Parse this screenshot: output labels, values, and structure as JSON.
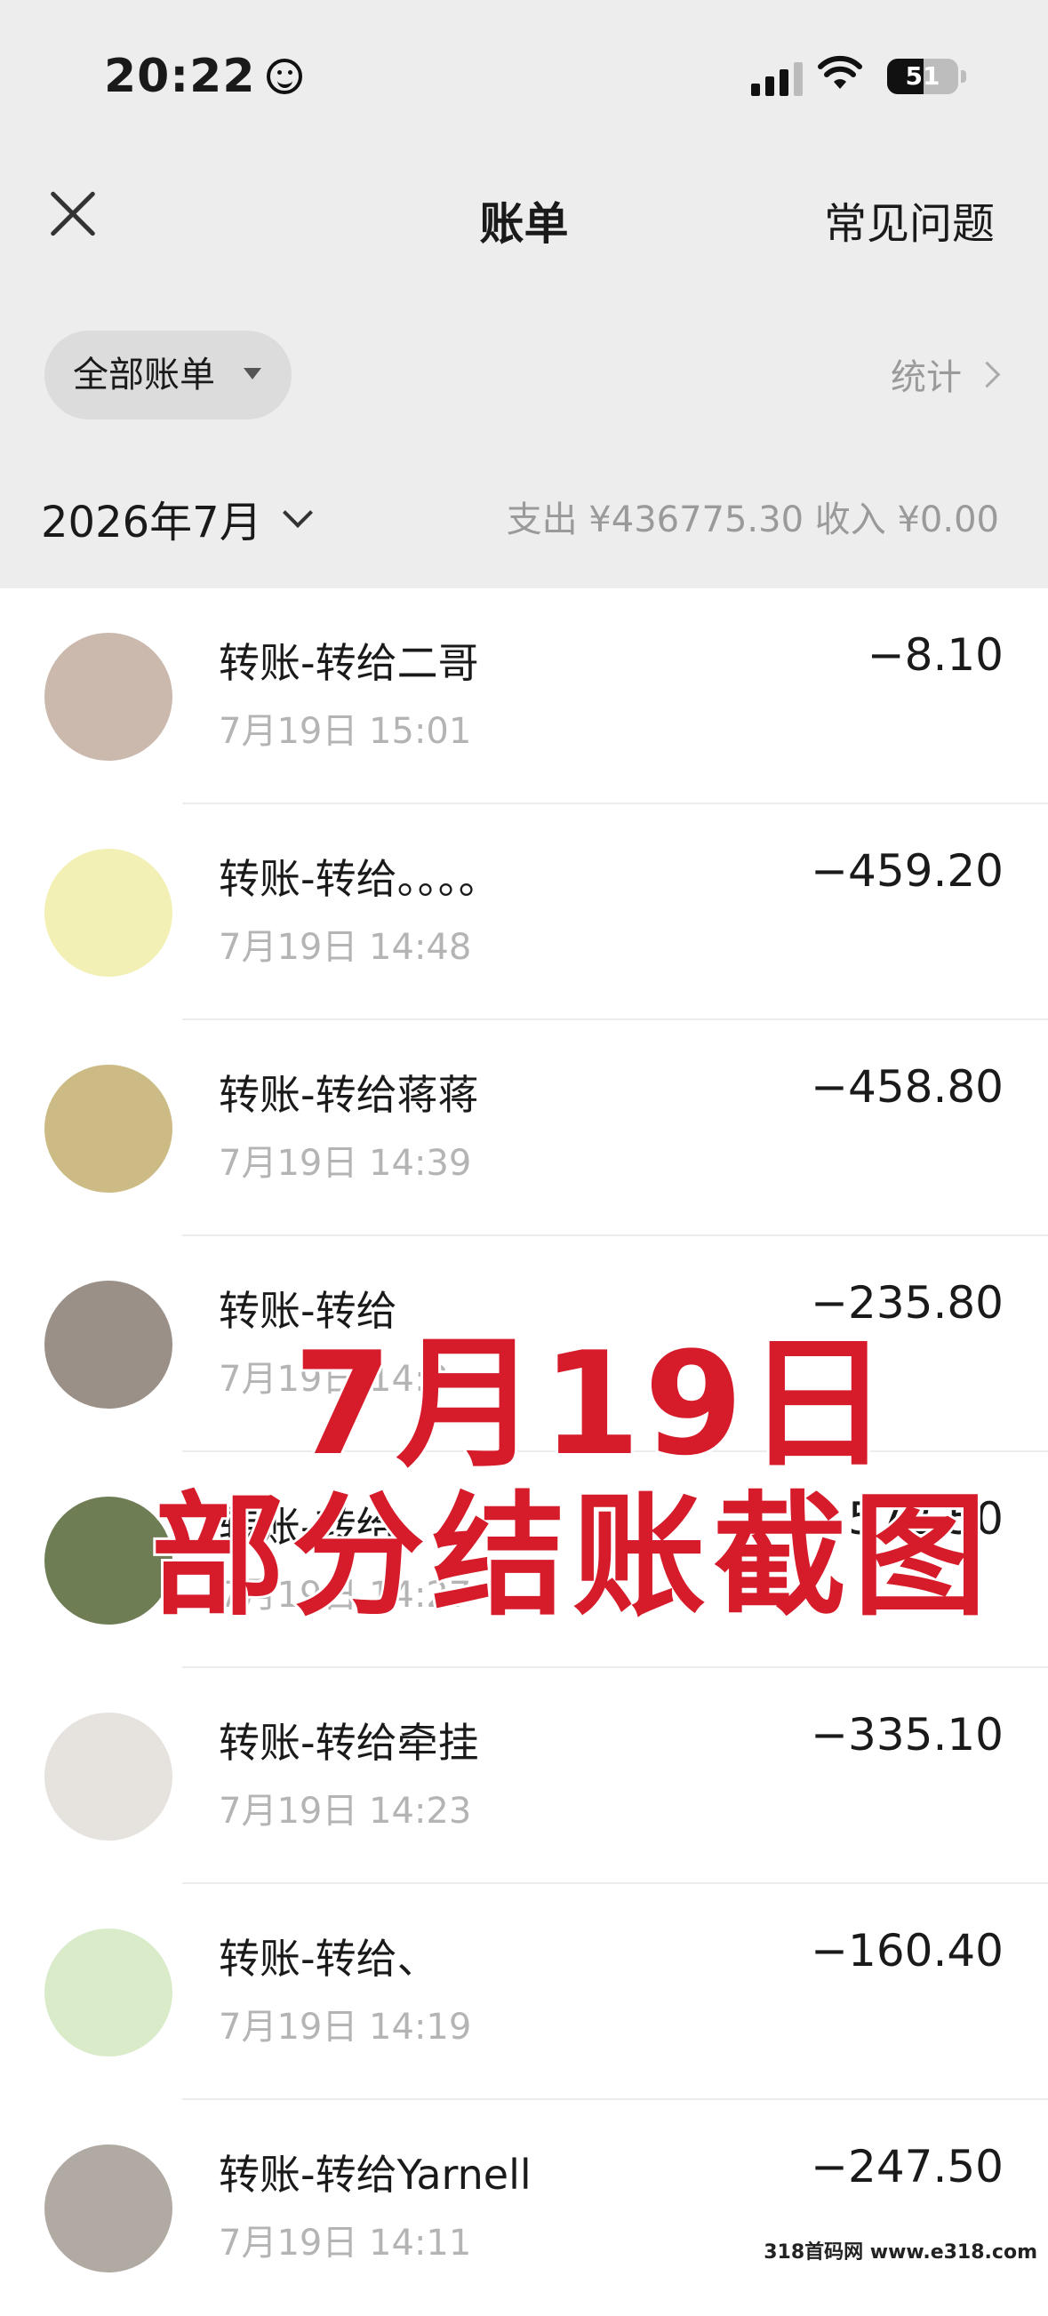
{
  "status_bar": {
    "time": "20:22",
    "battery": "51"
  },
  "nav": {
    "title": "账单",
    "faq": "常见问题"
  },
  "filter": {
    "label": "全部账单",
    "stats": "统计"
  },
  "month": {
    "label": "2026年7月",
    "summary": "支出 ¥436775.30  收入 ¥0.00"
  },
  "transactions": [
    {
      "name": "转账-转给二哥",
      "time": "7月19日 15:01",
      "amount": "−8.10",
      "avatar": "avatar-girl-icon",
      "avatar_color": "#cbb9ad"
    },
    {
      "name": "转账-转给。。。。",
      "time": "7月19日 14:48",
      "amount": "−459.20",
      "avatar": "avatar-cartoon-icon",
      "avatar_color": "#f3f0b5"
    },
    {
      "name": "转账-转给蒋蒋",
      "time": "7月19日 14:39",
      "amount": "−458.80",
      "avatar": "avatar-dog-icon",
      "avatar_color": "#cdbb85"
    },
    {
      "name": "转账-转给",
      "time": "7月19日 14:3",
      "amount": "−235.80",
      "avatar": "avatar-person-icon",
      "avatar_color": "#9a9088"
    },
    {
      "name": "转账-转给",
      "time": "7月19日 14:27",
      "amount": "572.50",
      "avatar": "avatar-plants-icon",
      "avatar_color": "#6f7d55"
    },
    {
      "name": "转账-转给牵挂",
      "time": "7月19日 14:23",
      "amount": "−335.10",
      "avatar": "avatar-anime-icon",
      "avatar_color": "#e6e2de"
    },
    {
      "name": "转账-转给、",
      "time": "7月19日 14:19",
      "amount": "−160.40",
      "avatar": "avatar-cat-icon",
      "avatar_color": "#d9ebc9"
    },
    {
      "name": "转账-转给Yarnell",
      "time": "7月19日 14:11",
      "amount": "−247.50",
      "avatar": "avatar-person-cap-icon",
      "avatar_color": "#b1aaa2"
    }
  ],
  "overlay": {
    "line1": "7月19日",
    "line2": "部分结账截图"
  },
  "watermark": "318首码网 www.e318.com",
  "colors": {
    "overlay_red": "#d61c2a",
    "header_bg": "#ededed"
  }
}
